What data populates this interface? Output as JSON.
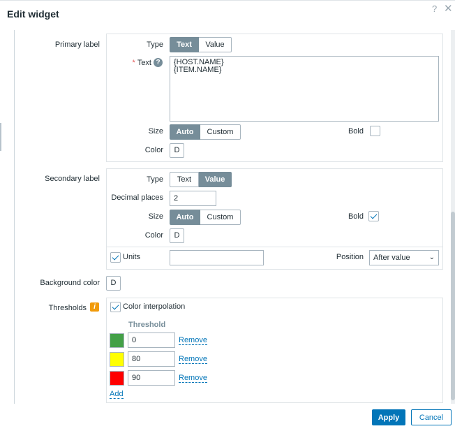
{
  "dialog": {
    "title": "Edit widget",
    "help_glyph": "?",
    "close_glyph": "✕"
  },
  "primary_label": {
    "label": "Primary label",
    "type_label": "Type",
    "type_options": [
      "Text",
      "Value"
    ],
    "type_selected": "Text",
    "required_mark": "*",
    "text_label": "Text",
    "text_value": "{HOST.NAME}\n{ITEM.NAME}",
    "size_label": "Size",
    "size_options": [
      "Auto",
      "Custom"
    ],
    "size_selected": "Auto",
    "bold_label": "Bold",
    "bold_checked": false,
    "color_label": "Color",
    "color_value": "D"
  },
  "secondary_label": {
    "label": "Secondary label",
    "type_label": "Type",
    "type_options": [
      "Text",
      "Value"
    ],
    "type_selected": "Value",
    "decimal_label": "Decimal places",
    "decimal_value": "2",
    "size_label": "Size",
    "size_options": [
      "Auto",
      "Custom"
    ],
    "size_selected": "Auto",
    "bold_label": "Bold",
    "bold_checked": true,
    "color_label": "Color",
    "color_value": "D",
    "units_label": "Units",
    "units_checked": true,
    "units_value": "",
    "position_label": "Position",
    "position_value": "After value",
    "caret_glyph": "⌄"
  },
  "background": {
    "label": "Background color",
    "color_value": "D"
  },
  "thresholds": {
    "label": "Thresholds",
    "info_glyph": "i",
    "interpolation_label": "Color interpolation",
    "interpolation_checked": true,
    "column_header": "Threshold",
    "rows": [
      {
        "color": "#43a047",
        "value": "0",
        "remove_label": "Remove"
      },
      {
        "color": "#ffff00",
        "value": "80",
        "remove_label": "Remove"
      },
      {
        "color": "#ff0000",
        "value": "90",
        "remove_label": "Remove"
      }
    ],
    "add_label": "Add"
  },
  "footer": {
    "apply_label": "Apply",
    "cancel_label": "Cancel"
  },
  "colors": {
    "accent": "#0275b8",
    "toggle_active": "#768d99",
    "border": "#a8b5bf",
    "warning": "#f19b0b"
  }
}
